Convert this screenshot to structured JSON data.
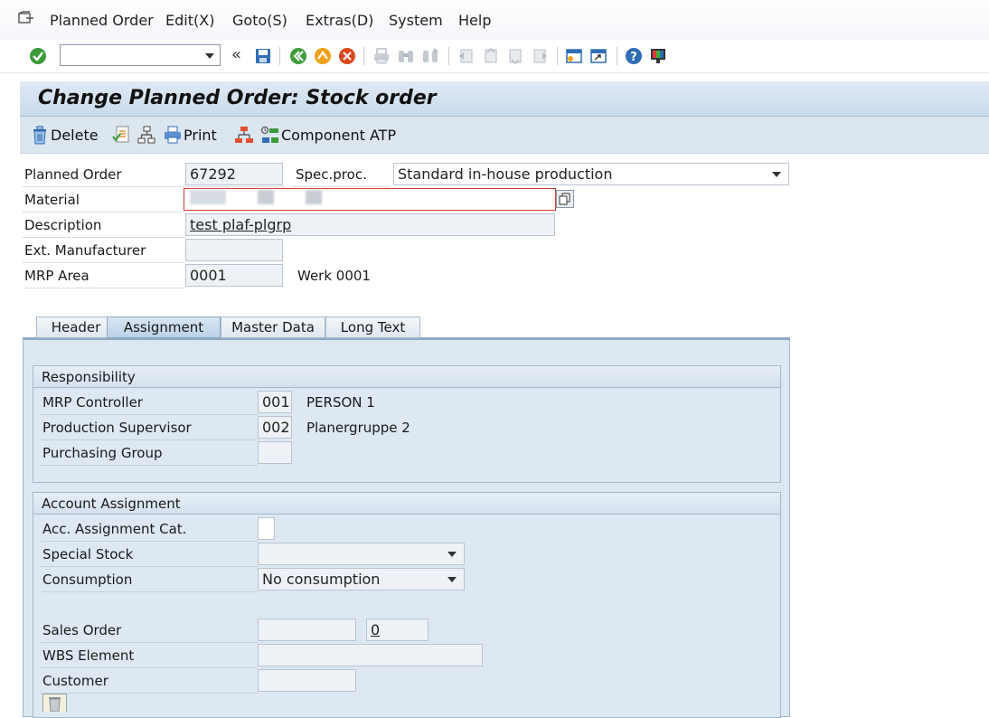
{
  "menu": {
    "items": [
      {
        "label": "Planned Order"
      },
      {
        "label": "Edit(X)"
      },
      {
        "label": "Goto(S)"
      },
      {
        "label": "Extras(D)"
      },
      {
        "label": "System"
      },
      {
        "label": "Help"
      }
    ]
  },
  "toolbar": {
    "command_value": "",
    "back_glyph": "«"
  },
  "title": "Change Planned Order: Stock order",
  "app_toolbar": {
    "delete_label": "Delete",
    "print_label": "Print",
    "component_atp_label": "Component ATP"
  },
  "header": {
    "planned_order_label": "Planned Order",
    "planned_order_value": "67292",
    "spec_proc_label": "Spec.proc.",
    "spec_proc_value": "Standard in-house production",
    "material_label": "Material",
    "material_value": "",
    "description_label": "Description",
    "description_value": "test plaf-plgrp",
    "ext_manufacturer_label": "Ext. Manufacturer",
    "ext_manufacturer_value": "",
    "mrp_area_label": "MRP Area",
    "mrp_area_value": "0001",
    "mrp_area_text": "Werk 0001"
  },
  "tabs": [
    {
      "label": "Header",
      "active": false
    },
    {
      "label": "Assignment",
      "active": true
    },
    {
      "label": "Master Data",
      "active": false
    },
    {
      "label": "Long Text",
      "active": false
    }
  ],
  "responsibility": {
    "title": "Responsibility",
    "mrp_controller_label": "MRP Controller",
    "mrp_controller_value": "001",
    "mrp_controller_text": "PERSON 1",
    "prod_supervisor_label": "Production Supervisor",
    "prod_supervisor_value": "002",
    "prod_supervisor_text": "Planergruppe 2",
    "purchasing_group_label": "Purchasing Group",
    "purchasing_group_value": ""
  },
  "account_assignment": {
    "title": "Account Assignment",
    "acc_cat_label": "Acc. Assignment Cat.",
    "acc_cat_value": "",
    "special_stock_label": "Special Stock",
    "special_stock_value": "",
    "consumption_label": "Consumption",
    "consumption_value": "No consumption",
    "sales_order_label": "Sales Order",
    "sales_order_value": "",
    "sales_order_item_value": "0",
    "wbs_label": "WBS Element",
    "wbs_value": "",
    "customer_label": "Customer",
    "customer_value": ""
  },
  "colors": {
    "title_bg": "#c9dbec",
    "panel_bg": "#dce7f1",
    "ok_green": "#3a9a3a",
    "cancel_red": "#d9481c"
  }
}
